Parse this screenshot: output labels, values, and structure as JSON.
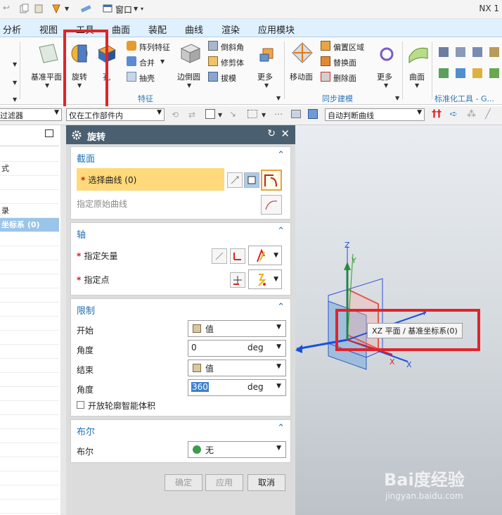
{
  "app": {
    "version_label": "NX 1"
  },
  "quick_access": {
    "window_label": "窗口"
  },
  "menu_tabs": [
    "分析",
    "视图",
    "工具",
    "曲面",
    "装配",
    "曲线",
    "渲染",
    "应用模块"
  ],
  "ribbon": {
    "items": {
      "datum_plane": "基准平面",
      "revolve": "旋转",
      "hole": "孔",
      "pattern_feature": "阵列特征",
      "unite": "合并",
      "shell": "抽壳",
      "edge_blend": "边倒圆",
      "chamfer": "倒斜角",
      "trim_body": "修剪体",
      "draft": "拔模",
      "more": "更多",
      "move_face": "移动面",
      "offset_region": "偏置区域",
      "replace_face": "替换面",
      "delete_face": "删除面",
      "more2": "更多",
      "surface": "曲面"
    },
    "groups": {
      "feature": "特征",
      "sync_modeling": "同步建模",
      "std_tools": "标准化工具 - G..."
    }
  },
  "filter_bar": {
    "type_filter": "过滤器",
    "scope": "仅在工作部件内",
    "curve_rule": "自动判断曲线"
  },
  "navigator": {
    "rows": [
      "",
      "式",
      "",
      "",
      "录",
      "坐标系 (0)"
    ]
  },
  "dialog": {
    "title": "旋转",
    "sections": {
      "section": {
        "title": "截面",
        "select_curve": "选择曲线 (0)",
        "specify_origin_curve": "指定原始曲线"
      },
      "axis": {
        "title": "轴",
        "specify_vector": "指定矢量",
        "specify_point": "指定点"
      },
      "limits": {
        "title": "限制",
        "start": "开始",
        "start_value": "值",
        "angle1": "角度",
        "angle1_value": "0",
        "angle1_unit": "deg",
        "end": "结束",
        "end_value": "值",
        "angle2": "角度",
        "angle2_value": "360",
        "angle2_unit": "deg",
        "open_profile": "开放轮廓智能体积"
      },
      "boolean": {
        "title": "布尔",
        "label": "布尔",
        "value": "无"
      }
    },
    "buttons": {
      "ok": "确定",
      "apply": "应用",
      "cancel": "取消"
    }
  },
  "graphics": {
    "tooltip": "XZ 平面 / 基准坐标系(0)",
    "axes": {
      "x": "X",
      "y": "Y",
      "z": "Z",
      "zc": "Z",
      "yc": "Y",
      "xc": "X"
    }
  },
  "watermark": {
    "brand": "Bai度经验",
    "url": "jingyan.baidu.com"
  },
  "colors": {
    "highlight_red": "#e0242a",
    "selection_yellow": "#ffd97a",
    "dialog_title": "#4a5f6f",
    "section_title": "#1f6fb4",
    "x_axis": "#e02020",
    "y_axis": "#2e9b2e",
    "z_axis": "#1b50d8"
  }
}
